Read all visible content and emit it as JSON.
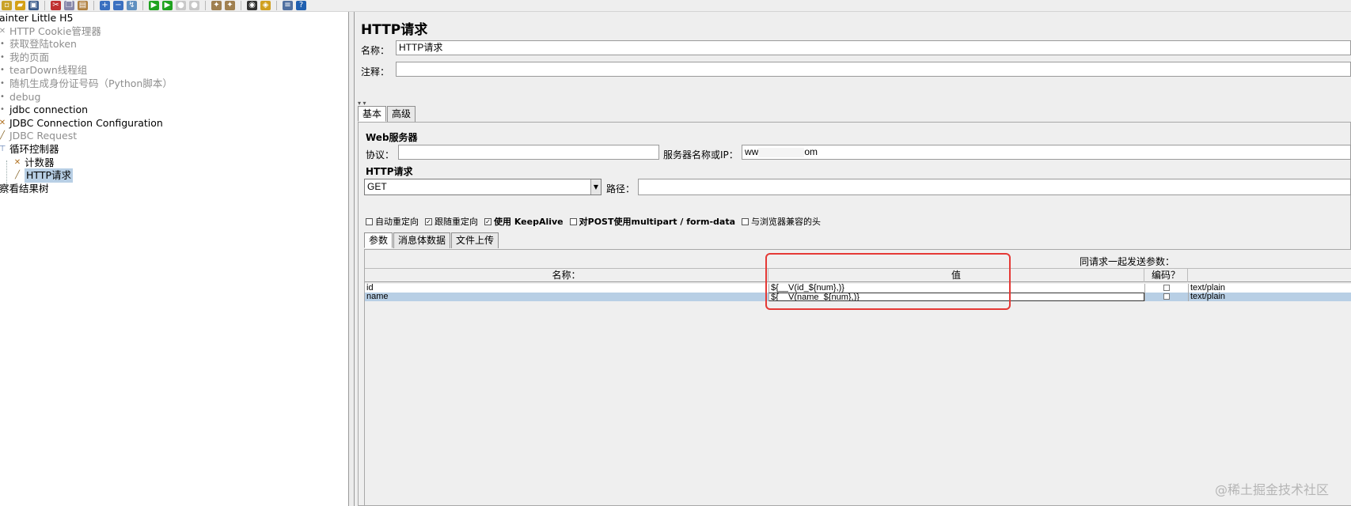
{
  "toolbar": {
    "buttons": [
      {
        "icon": "new-icon",
        "color": "#c9a227"
      },
      {
        "icon": "open-icon",
        "color": "#d4a017"
      },
      {
        "icon": "save-icon",
        "color": "#3a5a8a"
      },
      {
        "icon": "cut-icon",
        "color": "#c03030"
      },
      {
        "icon": "copy-icon",
        "color": "#8888aa"
      },
      {
        "icon": "paste-icon",
        "color": "#b08040"
      },
      {
        "icon": "expand-icon",
        "color": "#3a70c0"
      },
      {
        "icon": "collapse-icon",
        "color": "#3a70c0"
      },
      {
        "icon": "toggle-icon",
        "color": "#6090c0"
      },
      {
        "icon": "start-icon",
        "color": "#1fa21f"
      },
      {
        "icon": "start-no-pause-icon",
        "color": "#1fa21f"
      },
      {
        "icon": "stop-icon",
        "color": "#c8c8c8"
      },
      {
        "icon": "shutdown-icon",
        "color": "#c8c8c8"
      },
      {
        "icon": "clear-icon",
        "color": "#a08050"
      },
      {
        "icon": "clear-all-icon",
        "color": "#a08050"
      },
      {
        "icon": "search-icon",
        "color": "#303030"
      },
      {
        "icon": "reset-search-icon",
        "color": "#d0a020"
      },
      {
        "icon": "function-helper-icon",
        "color": "#5070a0"
      },
      {
        "icon": "help-icon",
        "color": "#2060b0"
      }
    ]
  },
  "tree": {
    "items": [
      {
        "label": "ainter Little H5",
        "dim": false,
        "indent": 0,
        "icon": ""
      },
      {
        "label": "HTTP Cookie管理器",
        "dim": true,
        "indent": 0,
        "icon": "wrench-icon"
      },
      {
        "label": "获取登陆token",
        "dim": true,
        "indent": 0,
        "icon": "node-icon"
      },
      {
        "label": "我的页面",
        "dim": true,
        "indent": 0,
        "icon": "node-icon"
      },
      {
        "label": "tearDown线程组",
        "dim": true,
        "indent": 0,
        "icon": "node-icon"
      },
      {
        "label": "随机生成身份证号码（Python脚本）",
        "dim": true,
        "indent": 0,
        "icon": "node-icon"
      },
      {
        "label": "debug",
        "dim": true,
        "indent": 0,
        "icon": "node-icon"
      },
      {
        "label": "jdbc connection",
        "dim": false,
        "indent": 0,
        "icon": "node-icon"
      },
      {
        "label": "JDBC Connection Configuration",
        "dim": false,
        "indent": 0,
        "icon": "config-icon"
      },
      {
        "label": "JDBC Request",
        "dim": true,
        "indent": 0,
        "icon": "sampler-icon"
      },
      {
        "label": "循环控制器",
        "dim": false,
        "indent": 0,
        "icon": "loop-controller-icon"
      },
      {
        "label": "计数器",
        "dim": false,
        "indent": 1,
        "icon": "config-icon"
      },
      {
        "label": "HTTP请求",
        "dim": false,
        "indent": 1,
        "icon": "sampler-icon",
        "selected": true
      },
      {
        "label": "察看结果树",
        "dim": false,
        "indent": 0,
        "icon": ""
      }
    ]
  },
  "panel": {
    "title": "HTTP请求",
    "name_label": "名称：",
    "name_value": "HTTP请求",
    "comment_label": "注释：",
    "comment_value": "",
    "tabs": [
      "基本",
      "高级"
    ],
    "web_server_label": "Web服务器",
    "protocol_label": "协议：",
    "protocol_value": "",
    "server_label": "服务器名称或IP：",
    "server_value_prefix": "ww",
    "server_value_suffix": "om",
    "http_request_label": "HTTP请求",
    "method_value": "GET",
    "path_label": "路径：",
    "path_value": "",
    "checkboxes": [
      {
        "label": "自动重定向",
        "checked": false
      },
      {
        "label": "跟随重定向",
        "checked": true
      },
      {
        "label": "使用 KeepAlive",
        "checked": true
      },
      {
        "label": "对POST使用multipart / form-data",
        "checked": false
      },
      {
        "label": "与浏览器兼容的头",
        "checked": false
      }
    ],
    "param_tabs": [
      "参数",
      "消息体数据",
      "文件上传"
    ],
    "params_caption": "同请求一起发送参数：",
    "columns": [
      "名称：",
      "值",
      "编码？",
      ""
    ],
    "rows": [
      {
        "name": "id",
        "value": "${__V(id_${num},)}",
        "encode": false,
        "content_type": "text/plain",
        "selected": false
      },
      {
        "name": "name",
        "value": "${__V(name_${num},)}",
        "encode": false,
        "content_type": "text/plain",
        "selected": true
      }
    ]
  },
  "watermark": "@稀土掘金技术社区",
  "colors": {
    "selection": "#b8cfe5",
    "highlight_box": "#e53935",
    "panel_bg": "#eeeeee"
  }
}
